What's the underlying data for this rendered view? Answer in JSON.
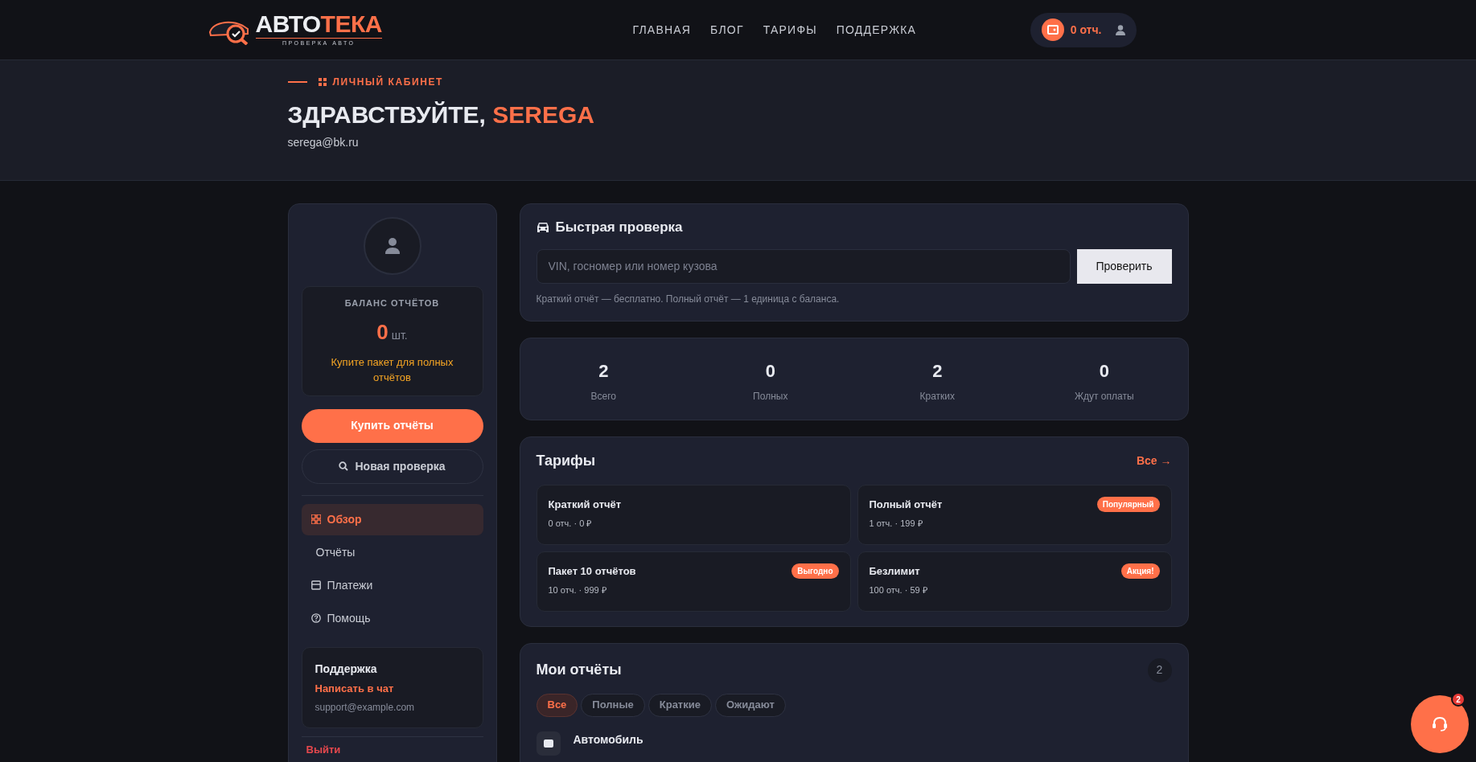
{
  "header": {
    "logo": {
      "title_light": "АВТО",
      "title_accent": "ТЕКА",
      "subtitle": "ПРОВЕРКА АВТО"
    },
    "nav": [
      {
        "label": "ГЛАВНАЯ"
      },
      {
        "label": "БЛОГ"
      },
      {
        "label": "ТАРИФЫ"
      },
      {
        "label": "ПОДДЕРЖКА"
      }
    ],
    "balance_pill": {
      "label": "0 отч."
    }
  },
  "hero": {
    "eyebrow": "ЛИЧНЫЙ КАБИНЕТ",
    "greeting": "ЗДРАВСТВУЙТЕ,",
    "user_name": "SEREGA",
    "email": "serega@bk.ru"
  },
  "sidebar": {
    "balance": {
      "title": "БАЛАНС ОТЧЁТОВ",
      "count": "0",
      "unit": "шт.",
      "hint": "Купите пакет для полных отчётов"
    },
    "buy_button": "Купить отчёты",
    "new_check_button": "Новая проверка",
    "menu": [
      {
        "label": "Обзор",
        "kind": "grid",
        "selected": true
      },
      {
        "label": "Отчёты",
        "kind": "plain",
        "selected": false
      },
      {
        "label": "Платежи",
        "kind": "card",
        "selected": false
      },
      {
        "label": "Помощь",
        "kind": "help",
        "selected": false
      }
    ],
    "support": {
      "title": "Поддержка",
      "chat_link": "Написать в чат",
      "email": "support@example.com"
    },
    "logout": "Выйти"
  },
  "quick_check": {
    "title": "Быстрая проверка",
    "placeholder": "VIN, госномер или номер кузова",
    "button": "Проверить",
    "note": "Краткий отчёт — бесплатно. Полный отчёт — 1 единица с баланса."
  },
  "stats": [
    {
      "value": "2",
      "label": "Всего"
    },
    {
      "value": "0",
      "label": "Полных"
    },
    {
      "value": "2",
      "label": "Кратких"
    },
    {
      "value": "0",
      "label": "Ждут оплаты"
    }
  ],
  "tariffs": {
    "title": "Тарифы",
    "all_link": "Все →",
    "items": [
      {
        "name": "Краткий отчёт",
        "details": "0 отч. · 0 ₽"
      },
      {
        "name": "Полный отчёт",
        "details": "1 отч. · 199 ₽",
        "badge": "Популярный"
      },
      {
        "name": "Пакет 10 отчётов",
        "details": "10 отч. · 999 ₽",
        "badge": "Выгодно"
      },
      {
        "name": "Безлимит",
        "details": "100 отч. · 59 ₽",
        "badge": "Акция!"
      }
    ]
  },
  "reports": {
    "title": "Мои отчёты",
    "count": "2",
    "filters": [
      {
        "label": "Все",
        "selected": true
      },
      {
        "label": "Полные",
        "selected": false
      },
      {
        "label": "Краткие",
        "selected": false
      },
      {
        "label": "Ожидают",
        "selected": false
      }
    ],
    "rows": [
      {
        "title": "Автомобиль"
      }
    ]
  },
  "support_button": {
    "badge": "2"
  }
}
